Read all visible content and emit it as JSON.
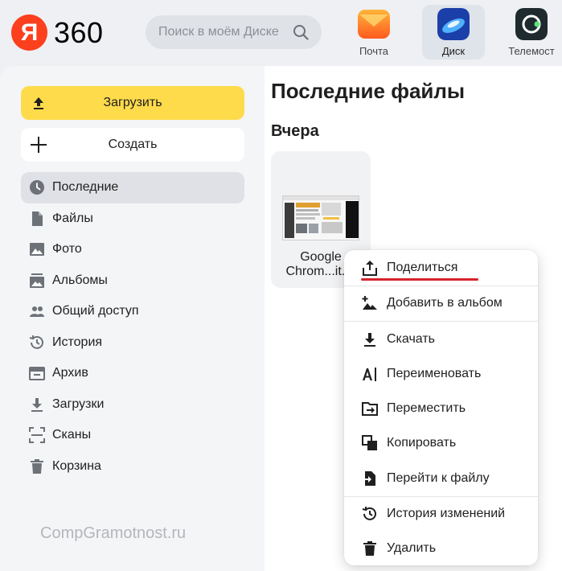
{
  "header": {
    "logo_letter": "Я",
    "logo_text": "360",
    "search_placeholder": "Поиск в моём Диске",
    "apps": [
      {
        "label": "Почта",
        "icon": "mail-icon"
      },
      {
        "label": "Диск",
        "icon": "disk-icon",
        "active": true
      },
      {
        "label": "Телемост",
        "icon": "telemost-icon"
      }
    ]
  },
  "sidebar": {
    "upload_label": "Загрузить",
    "create_label": "Создать",
    "items": [
      {
        "label": "Последние",
        "icon": "clock-icon",
        "active": true
      },
      {
        "label": "Файлы",
        "icon": "file-icon"
      },
      {
        "label": "Фото",
        "icon": "image-icon"
      },
      {
        "label": "Альбомы",
        "icon": "albums-icon"
      },
      {
        "label": "Общий доступ",
        "icon": "people-icon"
      },
      {
        "label": "История",
        "icon": "history-icon"
      },
      {
        "label": "Архив",
        "icon": "archive-icon"
      },
      {
        "label": "Загрузки",
        "icon": "download-icon"
      },
      {
        "label": "Сканы",
        "icon": "scan-icon"
      },
      {
        "label": "Корзина",
        "icon": "trash-icon"
      }
    ]
  },
  "watermark": "CompGramotnost.ru",
  "main": {
    "title": "Последние файлы",
    "section": "Вчера",
    "file": {
      "name_line1": "Google",
      "name_line2": "Chrom...it.m"
    }
  },
  "context_menu": {
    "items": [
      {
        "label": "Поделиться",
        "icon": "share-icon"
      },
      {
        "label": "Добавить в альбом",
        "icon": "add-to-album-icon"
      },
      {
        "label": "Скачать",
        "icon": "download-icon"
      },
      {
        "label": "Переименовать",
        "icon": "rename-icon"
      },
      {
        "label": "Переместить",
        "icon": "move-icon"
      },
      {
        "label": "Копировать",
        "icon": "copy-icon"
      },
      {
        "label": "Перейти к файлу",
        "icon": "go-to-file-icon"
      },
      {
        "label": "История изменений",
        "icon": "version-history-icon"
      },
      {
        "label": "Удалить",
        "icon": "trash-icon"
      }
    ]
  },
  "colors": {
    "accent_yellow": "#fedb4b",
    "brand_red": "#fc3f1d",
    "underline_red": "#d6232b"
  }
}
